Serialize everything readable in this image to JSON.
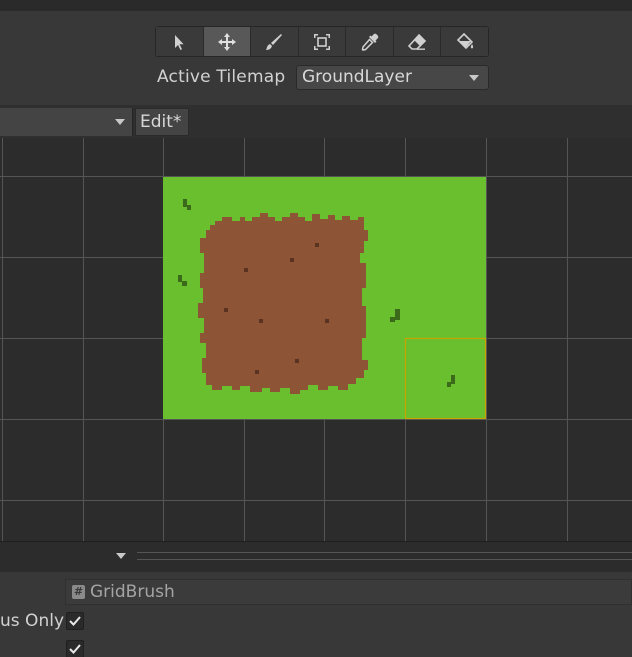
{
  "toolbar": {
    "tools": [
      {
        "icon": "select-arrow-icon",
        "active": false
      },
      {
        "icon": "move-icon",
        "active": true
      },
      {
        "icon": "paint-brush-icon",
        "active": false
      },
      {
        "icon": "box-fill-icon",
        "active": false
      },
      {
        "icon": "eyedropper-icon",
        "active": false
      },
      {
        "icon": "eraser-icon",
        "active": false
      },
      {
        "icon": "fill-bucket-icon",
        "active": false
      }
    ],
    "active_tilemap_label": "Active Tilemap",
    "active_tilemap_value": "GroundLayer"
  },
  "palette_bar": {
    "edit_label": "Edit*"
  },
  "inspector": {
    "brush_value": "GridBrush",
    "row_label": "ous Only",
    "checkboxes": [
      true,
      true
    ]
  },
  "colors": {
    "grass": "#6abf2e",
    "dirt": "#8d5535",
    "selection": "#c8a400",
    "grid_line": "#5a5a5a"
  }
}
